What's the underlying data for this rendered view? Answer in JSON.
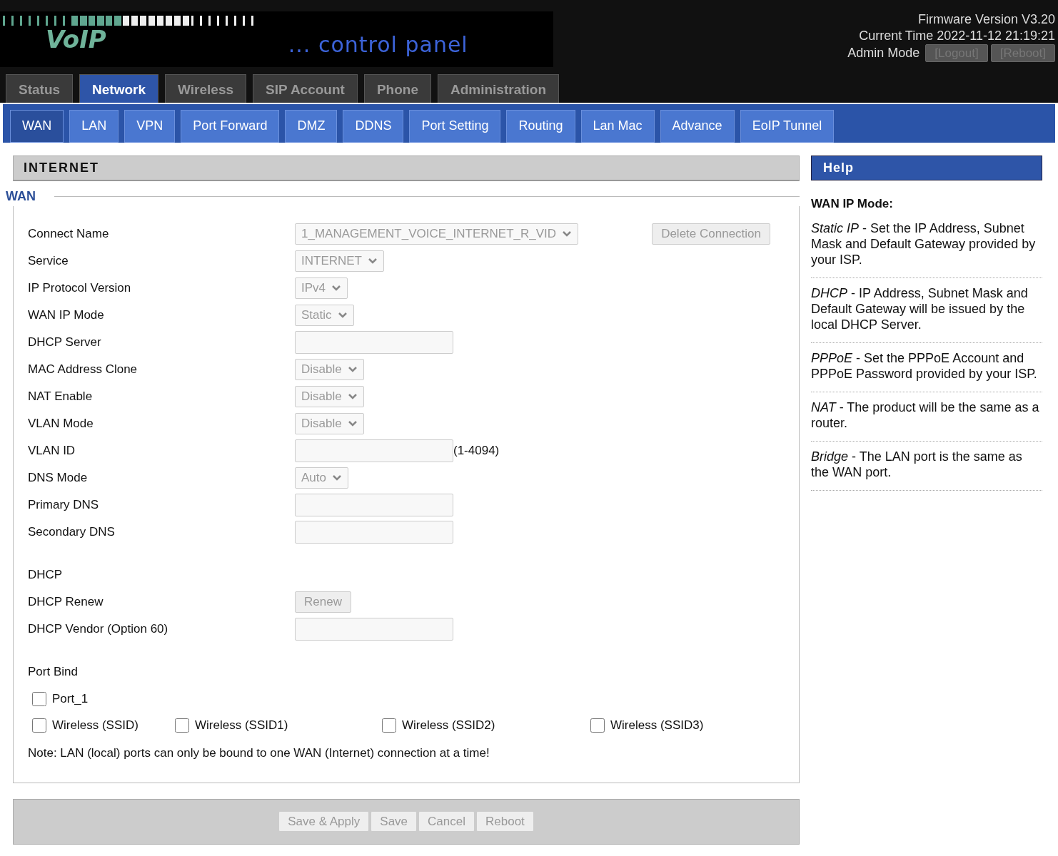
{
  "header": {
    "logo": "VoIP",
    "tagline": "... control panel",
    "firmware": "Firmware Version V3.20",
    "time": "Current Time 2022-11-12 21:19:21",
    "mode": "Admin Mode",
    "buttons": [
      {
        "label": "[Logout]",
        "disabled": true
      },
      {
        "label": "[Reboot]",
        "disabled": true
      }
    ]
  },
  "tabs": [
    {
      "label": "Status",
      "selected": false
    },
    {
      "label": "Network",
      "selected": true
    },
    {
      "label": "Wireless",
      "selected": false
    },
    {
      "label": "SIP Account",
      "selected": false
    },
    {
      "label": "Phone",
      "selected": false
    },
    {
      "label": "Administration",
      "selected": false
    }
  ],
  "subtabs": [
    {
      "label": "WAN",
      "selected": true
    },
    {
      "label": "LAN",
      "selected": false
    },
    {
      "label": "VPN",
      "selected": false
    },
    {
      "label": "Port Forward",
      "selected": false
    },
    {
      "label": "DMZ",
      "selected": false
    },
    {
      "label": "DDNS",
      "selected": false
    },
    {
      "label": "Port Setting",
      "selected": false
    },
    {
      "label": "Routing",
      "selected": false
    },
    {
      "label": "Lan Mac",
      "selected": false
    },
    {
      "label": "Advance",
      "selected": false
    },
    {
      "label": "EoIP Tunnel",
      "selected": false
    }
  ],
  "section_title": "INTERNET",
  "group_title": "WAN",
  "rows": [
    {
      "label": "Connect Name",
      "kind": "select",
      "value": "1_MANAGEMENT_VOICE_INTERNET_R_VID",
      "disabled": true,
      "action": "Delete Connection"
    },
    {
      "label": "Service",
      "kind": "select",
      "value": "INTERNET",
      "disabled": true
    },
    {
      "label": "IP Protocol Version",
      "kind": "select",
      "value": "IPv4",
      "disabled": true
    },
    {
      "label": "WAN IP Mode",
      "kind": "select",
      "value": "Static",
      "disabled": true
    },
    {
      "label": "DHCP Server",
      "kind": "input",
      "disabled": true
    },
    {
      "label": "MAC Address Clone",
      "kind": "select",
      "value": "Disable",
      "disabled": true
    },
    {
      "label": "NAT Enable",
      "kind": "select",
      "value": "Disable",
      "disabled": true
    },
    {
      "label": "VLAN Mode",
      "kind": "select",
      "value": "Disable",
      "disabled": true
    },
    {
      "label": "VLAN ID",
      "kind": "input",
      "disabled": true,
      "hint": "(1-4094)"
    },
    {
      "label": "DNS Mode",
      "kind": "select",
      "value": "Auto",
      "disabled": true
    },
    {
      "label": "Primary DNS",
      "kind": "input",
      "disabled": true
    },
    {
      "label": "Secondary DNS",
      "kind": "input",
      "disabled": true
    },
    {
      "label": "DHCP",
      "kind": "heading"
    },
    {
      "label": "DHCP Renew",
      "kind": "button",
      "value": "Renew",
      "disabled": true
    },
    {
      "label": "DHCP Vendor (Option 60)",
      "kind": "input",
      "disabled": true
    },
    {
      "label": "Port Bind",
      "kind": "heading"
    }
  ],
  "port_bind": [
    [
      {
        "label": "Port_1",
        "checked": false
      }
    ],
    [
      {
        "label": "Wireless (SSID)",
        "checked": false
      },
      {
        "label": "Wireless (SSID1)",
        "checked": false
      },
      {
        "label": "Wireless (SSID2)",
        "checked": false
      },
      {
        "label": "Wireless (SSID3)",
        "checked": false
      }
    ]
  ],
  "note": "Note: LAN (local) ports can only be bound to one WAN (Internet) connection at a time!",
  "footer_buttons": [
    {
      "label": "Save & Apply",
      "disabled": true
    },
    {
      "label": "Save",
      "disabled": true
    },
    {
      "label": "Cancel",
      "disabled": true
    },
    {
      "label": "Reboot",
      "disabled": true
    }
  ],
  "help": {
    "title": "Help",
    "heading": "WAN IP Mode:",
    "items": [
      "*Static IP* - Set the IP Address, Subnet Mask and Default Gateway provided by your ISP.",
      "*DHCP* - IP Address, Subnet Mask and Default Gateway will be issued by the local DHCP Server.",
      "*PPPoE* - Set the PPPoE Account and PPPoE Password provided by your ISP.",
      "*NAT* - The product will be the same as a router.",
      "*Bridge* - The LAN port is the same as the WAN port."
    ]
  }
}
